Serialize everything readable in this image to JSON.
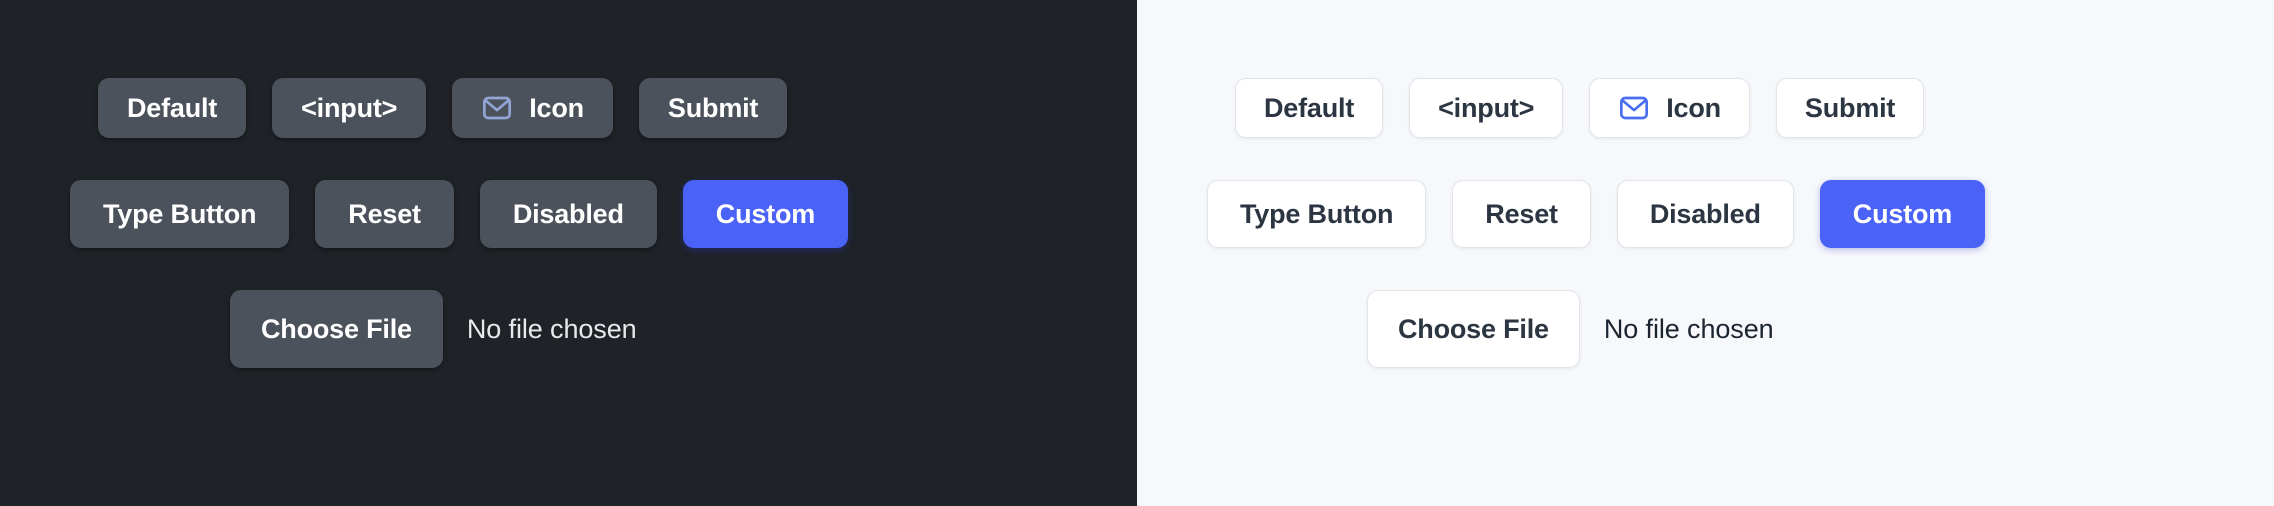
{
  "panels": [
    {
      "theme": "dark",
      "background": "#1f2227",
      "accent_color": "#4a62f5",
      "icon_color": "#92a5d6",
      "text_color": "#ffffff",
      "rows": [
        {
          "name": "row-primary",
          "buttons": [
            {
              "label": "Default",
              "variant": "default",
              "icon": null
            },
            {
              "label": "<input>",
              "variant": "default",
              "icon": null
            },
            {
              "label": "Icon",
              "variant": "default",
              "icon": "mail-icon"
            },
            {
              "label": "Submit",
              "variant": "default",
              "icon": null
            }
          ]
        },
        {
          "name": "row-secondary",
          "buttons": [
            {
              "label": "Type Button",
              "variant": "default",
              "icon": null
            },
            {
              "label": "Reset",
              "variant": "default",
              "icon": null
            },
            {
              "label": "Disabled",
              "variant": "default",
              "icon": null
            },
            {
              "label": "Custom",
              "variant": "accent",
              "icon": null
            }
          ]
        }
      ],
      "file_input": {
        "button_label": "Choose File",
        "status_text": "No file chosen"
      }
    },
    {
      "theme": "light",
      "background": "#f6f8fb",
      "accent_color": "#4a62f5",
      "icon_color": "#4a6ef0",
      "text_color": "#2c3542",
      "rows": [
        {
          "name": "row-primary",
          "buttons": [
            {
              "label": "Default",
              "variant": "default",
              "icon": null
            },
            {
              "label": "<input>",
              "variant": "default",
              "icon": null
            },
            {
              "label": "Icon",
              "variant": "default",
              "icon": "mail-icon"
            },
            {
              "label": "Submit",
              "variant": "default",
              "icon": null
            }
          ]
        },
        {
          "name": "row-secondary",
          "buttons": [
            {
              "label": "Type Button",
              "variant": "default",
              "icon": null
            },
            {
              "label": "Reset",
              "variant": "default",
              "icon": null
            },
            {
              "label": "Disabled",
              "variant": "default",
              "icon": null
            },
            {
              "label": "Custom",
              "variant": "accent",
              "icon": null
            }
          ]
        }
      ],
      "file_input": {
        "button_label": "Choose File",
        "status_text": "No file chosen"
      }
    }
  ]
}
